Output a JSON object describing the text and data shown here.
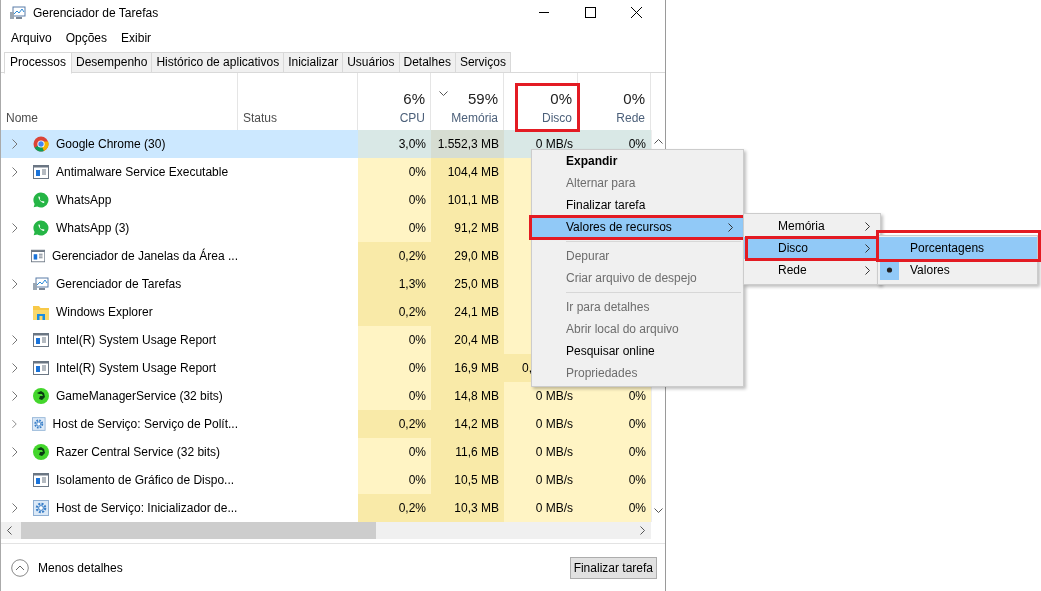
{
  "window": {
    "title": "Gerenciador de Tarefas"
  },
  "menu_bar": [
    "Arquivo",
    "Opções",
    "Exibir"
  ],
  "tabs": [
    {
      "label": "Processos",
      "selected": true
    },
    {
      "label": "Desempenho",
      "selected": false
    },
    {
      "label": "Histórico de aplicativos",
      "selected": false
    },
    {
      "label": "Inicializar",
      "selected": false
    },
    {
      "label": "Usuários",
      "selected": false
    },
    {
      "label": "Detalhes",
      "selected": false
    },
    {
      "label": "Serviços",
      "selected": false
    }
  ],
  "columns": [
    {
      "label": "Nome"
    },
    {
      "label": "Status"
    },
    {
      "label": "CPU",
      "total": "6%"
    },
    {
      "label": "Memória",
      "total": "59%",
      "sorted": true
    },
    {
      "label": "Disco",
      "total": "0%",
      "highlighted": true
    },
    {
      "label": "Rede",
      "total": "0%"
    }
  ],
  "rows": [
    {
      "name": "Google Chrome (30)",
      "kind": "chrome",
      "expandable": true,
      "selected": true,
      "cpu": {
        "text": "3,0%",
        "color": "#d9e8e6"
      },
      "memory": {
        "text": "1.552,3 MB",
        "color": "#d6ddd2"
      },
      "disk": {
        "text": "0 MB/s"
      },
      "network": {
        "text": "0%"
      }
    },
    {
      "name": "Antimalware Service Executable",
      "kind": "window",
      "expandable": true,
      "selected": false,
      "cpu": {
        "text": "0%",
        "color": "#fff4c4"
      },
      "memory": {
        "text": "104,4 MB",
        "color": "#f9eaa8"
      }
    },
    {
      "name": "WhatsApp",
      "kind": "whatsapp",
      "expandable": false,
      "selected": false,
      "cpu": {
        "text": "0%",
        "color": "#fff4c4"
      },
      "memory": {
        "text": "101,1 MB",
        "color": "#f9eaa8"
      }
    },
    {
      "name": "WhatsApp (3)",
      "kind": "whatsapp",
      "expandable": true,
      "selected": false,
      "cpu": {
        "text": "0%",
        "color": "#fff4c4"
      },
      "memory": {
        "text": "91,2 MB",
        "color": "#f9eaa8"
      }
    },
    {
      "name": "Gerenciador de Janelas da Área ...",
      "kind": "window",
      "expandable": false,
      "selected": false,
      "cpu": {
        "text": "0,2%",
        "color": "#f9eaa8"
      },
      "memory": {
        "text": "29,0 MB",
        "color": "#f9eaa8"
      }
    },
    {
      "name": "Gerenciador de Tarefas",
      "kind": "monitor",
      "expandable": true,
      "selected": false,
      "cpu": {
        "text": "1,3%",
        "color": "#f9eaa8"
      },
      "memory": {
        "text": "25,0 MB",
        "color": "#f9eaa8"
      }
    },
    {
      "name": "Windows Explorer",
      "kind": "folder",
      "expandable": false,
      "selected": false,
      "cpu": {
        "text": "0,2%",
        "color": "#f9eaa8"
      },
      "memory": {
        "text": "24,1 MB",
        "color": "#f9eaa8"
      }
    },
    {
      "name": "Intel(R) System Usage Report",
      "kind": "window",
      "expandable": true,
      "selected": false,
      "cpu": {
        "text": "0%",
        "color": "#fff4c4"
      },
      "memory": {
        "text": "20,4 MB",
        "color": "#f9eaa8"
      }
    },
    {
      "name": "Intel(R) System Usage Report",
      "kind": "window",
      "expandable": true,
      "selected": false,
      "cpu": {
        "text": "0%",
        "color": "#fff4c4"
      },
      "memory": {
        "text": "16,9 MB",
        "color": "#f9eaa8"
      },
      "disk": {
        "text": "0,",
        "cut_by_menu": true,
        "color": "#f9eaa8"
      }
    },
    {
      "name": "GameManagerService (32 bits)",
      "kind": "razer",
      "expandable": true,
      "selected": false,
      "cpu": {
        "text": "0%",
        "color": "#fff4c4"
      },
      "memory": {
        "text": "14,8 MB",
        "color": "#f9eaa8"
      },
      "disk": {
        "text": "0 MB/s"
      },
      "network": {
        "text": "0%"
      }
    },
    {
      "name": "Host de Serviço: Serviço de Polít...",
      "kind": "gear",
      "expandable": true,
      "selected": false,
      "cpu": {
        "text": "0,2%",
        "color": "#f9eaa8"
      },
      "memory": {
        "text": "14,2 MB",
        "color": "#f9eaa8"
      },
      "disk": {
        "text": "0 MB/s"
      },
      "network": {
        "text": "0%"
      }
    },
    {
      "name": "Razer Central Service (32 bits)",
      "kind": "razer",
      "expandable": true,
      "selected": false,
      "cpu": {
        "text": "0%",
        "color": "#fff4c4"
      },
      "memory": {
        "text": "11,6 MB",
        "color": "#f9eaa8"
      },
      "disk": {
        "text": "0 MB/s"
      },
      "network": {
        "text": "0%"
      }
    },
    {
      "name": "Isolamento de Gráfico de Dispo...",
      "kind": "window",
      "expandable": false,
      "selected": false,
      "cpu": {
        "text": "0%",
        "color": "#fff4c4"
      },
      "memory": {
        "text": "10,5 MB",
        "color": "#f9eaa8"
      },
      "disk": {
        "text": "0 MB/s"
      },
      "network": {
        "text": "0%"
      }
    },
    {
      "name": "Host de Serviço: Inicializador de...",
      "kind": "gear",
      "expandable": true,
      "selected": false,
      "cpu": {
        "text": "0,2%",
        "color": "#f9eaa8"
      },
      "memory": {
        "text": "10,3 MB",
        "color": "#f9eaa8"
      },
      "disk": {
        "text": "0 MB/s"
      },
      "network": {
        "text": "0%"
      }
    }
  ],
  "footer": {
    "link": "Menos detalhes",
    "button": "Finalizar tarefa"
  },
  "context_menu": {
    "items": [
      {
        "kind": "bold",
        "label": "Expandir",
        "selected": false
      },
      {
        "kind": "disabled",
        "label": "Alternar para",
        "selected": false
      },
      {
        "kind": "item",
        "label": "Finalizar tarefa",
        "selected": false
      },
      {
        "kind": "item",
        "label": "Valores de recursos",
        "selected": true,
        "submenu": true,
        "highlighted": true
      },
      {
        "kind": "separator"
      },
      {
        "kind": "disabled",
        "label": "Depurar",
        "selected": false
      },
      {
        "kind": "disabled",
        "label": "Criar arquivo de despejo",
        "selected": false
      },
      {
        "kind": "separator"
      },
      {
        "kind": "disabled",
        "label": "Ir para detalhes",
        "selected": false
      },
      {
        "kind": "disabled",
        "label": "Abrir local do arquivo",
        "selected": false
      },
      {
        "kind": "item",
        "label": "Pesquisar online",
        "selected": false
      },
      {
        "kind": "disabled",
        "label": "Propriedades",
        "selected": false
      }
    ]
  },
  "resource_submenu": {
    "items": [
      {
        "label": "Memória",
        "selected": false
      },
      {
        "label": "Disco",
        "selected": true,
        "highlighted": true
      },
      {
        "label": "Rede",
        "selected": false
      }
    ]
  },
  "disk_submenu": {
    "items": [
      {
        "label": "Porcentagens",
        "selected": true,
        "checked": false,
        "highlighted": true
      },
      {
        "label": "Valores",
        "selected": false,
        "checked": true
      }
    ]
  }
}
